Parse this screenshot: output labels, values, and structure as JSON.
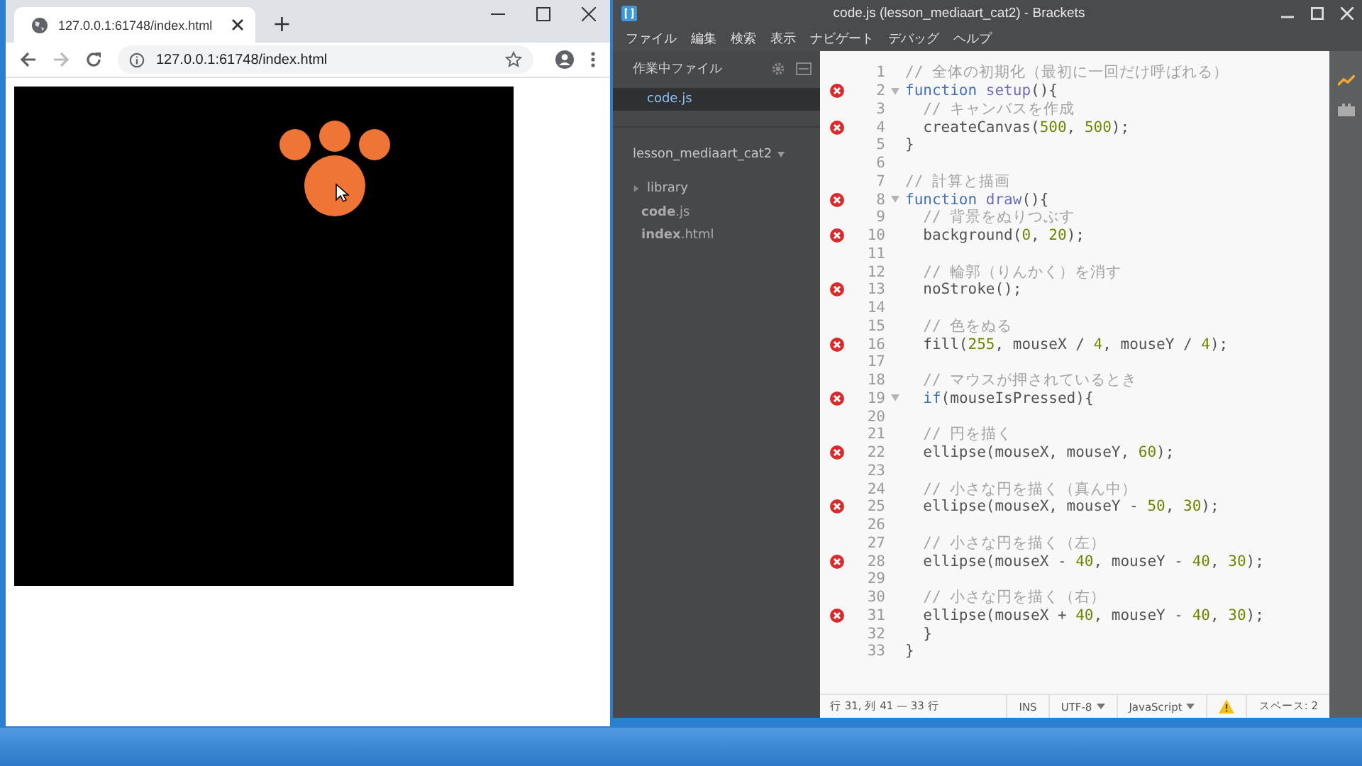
{
  "browser": {
    "tab_title": "127.0.0.1:61748/index.html",
    "new_tab": "+",
    "url": "127.0.0.1:61748/index.html"
  },
  "editor": {
    "title": "code.js (lesson_mediaart_cat2) - Brackets",
    "menu": [
      "ファイル",
      "編集",
      "検索",
      "表示",
      "ナビゲート",
      "デバッグ",
      "ヘルプ"
    ],
    "working_files": {
      "title": "作業中ファイル",
      "items": [
        {
          "name": "code.js",
          "selected": true
        }
      ]
    },
    "project": {
      "name": "lesson_mediaart_cat2",
      "tree": [
        {
          "name": "library",
          "kind": "folder",
          "expanded": false
        },
        {
          "name": "**code**.js",
          "kind": "file"
        },
        {
          "name": "**index**.html",
          "kind": "file"
        }
      ]
    },
    "lines": [
      {
        "number": "1",
        "error": false,
        "fold": false,
        "tokens": [
          {
            "kind": "comment",
            "text": "// 全体の初期化（最初に一回だけ呼ばれる）"
          }
        ]
      },
      {
        "number": "2",
        "error": true,
        "fold": true,
        "tokens": [
          {
            "kind": "keyword",
            "text": "function "
          },
          {
            "kind": "def",
            "text": "setup"
          },
          {
            "kind": "plain",
            "text": "(){"
          }
        ]
      },
      {
        "number": "3",
        "error": false,
        "fold": false,
        "tokens": [
          {
            "kind": "comment",
            "text": "  // キャンバスを作成"
          }
        ]
      },
      {
        "number": "4",
        "error": true,
        "fold": false,
        "tokens": [
          {
            "kind": "plain",
            "text": "  createCanvas("
          },
          {
            "kind": "number",
            "text": "500"
          },
          {
            "kind": "plain",
            "text": ", "
          },
          {
            "kind": "number",
            "text": "500"
          },
          {
            "kind": "plain",
            "text": ");"
          }
        ]
      },
      {
        "number": "5",
        "error": false,
        "fold": false,
        "tokens": [
          {
            "kind": "plain",
            "text": "}"
          }
        ]
      },
      {
        "number": "6",
        "error": false,
        "fold": false
      },
      {
        "number": "7",
        "error": false,
        "fold": false,
        "tokens": [
          {
            "kind": "comment",
            "text": "// 計算と描画"
          }
        ]
      },
      {
        "number": "8",
        "error": true,
        "fold": true,
        "tokens": [
          {
            "kind": "keyword",
            "text": "function "
          },
          {
            "kind": "def",
            "text": "draw"
          },
          {
            "kind": "plain",
            "text": "(){"
          }
        ]
      },
      {
        "number": "9",
        "error": false,
        "fold": false,
        "tokens": [
          {
            "kind": "comment",
            "text": "  // 背景をぬりつぶす"
          }
        ]
      },
      {
        "number": "10",
        "error": true,
        "fold": false,
        "tokens": [
          {
            "kind": "plain",
            "text": "  background("
          },
          {
            "kind": "number",
            "text": "0"
          },
          {
            "kind": "plain",
            "text": ", "
          },
          {
            "kind": "number",
            "text": "20"
          },
          {
            "kind": "plain",
            "text": ");"
          }
        ]
      },
      {
        "number": "11",
        "error": false,
        "fold": false
      },
      {
        "number": "12",
        "error": false,
        "fold": false,
        "tokens": [
          {
            "kind": "comment",
            "text": "  // 輪郭（りんかく）を消す"
          }
        ]
      },
      {
        "number": "13",
        "error": true,
        "fold": false,
        "tokens": [
          {
            "kind": "plain",
            "text": "  noStroke();"
          }
        ]
      },
      {
        "number": "14",
        "error": false,
        "fold": false
      },
      {
        "number": "15",
        "error": false,
        "fold": false,
        "tokens": [
          {
            "kind": "comment",
            "text": "  // 色をぬる"
          }
        ]
      },
      {
        "number": "16",
        "error": true,
        "fold": false,
        "tokens": [
          {
            "kind": "plain",
            "text": "  fill("
          },
          {
            "kind": "number",
            "text": "255"
          },
          {
            "kind": "plain",
            "text": ", mouseX / "
          },
          {
            "kind": "number",
            "text": "4"
          },
          {
            "kind": "plain",
            "text": ", mouseY / "
          },
          {
            "kind": "number",
            "text": "4"
          },
          {
            "kind": "plain",
            "text": ");"
          }
        ]
      },
      {
        "number": "17",
        "error": false,
        "fold": false
      },
      {
        "number": "18",
        "error": false,
        "fold": false,
        "tokens": [
          {
            "kind": "comment",
            "text": "  // マウスが押されているとき"
          }
        ]
      },
      {
        "number": "19",
        "error": true,
        "fold": true,
        "tokens": [
          {
            "kind": "keyword",
            "text": "  if"
          },
          {
            "kind": "plain",
            "text": "(mouseIsPressed){"
          }
        ]
      },
      {
        "number": "20",
        "error": false,
        "fold": false
      },
      {
        "number": "21",
        "error": false,
        "fold": false,
        "tokens": [
          {
            "kind": "comment",
            "text": "  // 円を描く"
          }
        ]
      },
      {
        "number": "22",
        "error": true,
        "fold": false,
        "tokens": [
          {
            "kind": "plain",
            "text": "  ellipse(mouseX, mouseY, "
          },
          {
            "kind": "number",
            "text": "60"
          },
          {
            "kind": "plain",
            "text": ");"
          }
        ]
      },
      {
        "number": "23",
        "error": false,
        "fold": false
      },
      {
        "number": "24",
        "error": false,
        "fold": false,
        "tokens": [
          {
            "kind": "comment",
            "text": "  // 小さな円を描く（真ん中）"
          }
        ]
      },
      {
        "number": "25",
        "error": true,
        "fold": false,
        "tokens": [
          {
            "kind": "plain",
            "text": "  ellipse(mouseX, mouseY - "
          },
          {
            "kind": "number",
            "text": "50"
          },
          {
            "kind": "plain",
            "text": ", "
          },
          {
            "kind": "number",
            "text": "30"
          },
          {
            "kind": "plain",
            "text": ");"
          }
        ]
      },
      {
        "number": "26",
        "error": false,
        "fold": false
      },
      {
        "number": "27",
        "error": false,
        "fold": false,
        "tokens": [
          {
            "kind": "comment",
            "text": "  // 小さな円を描く（左）"
          }
        ]
      },
      {
        "number": "28",
        "error": true,
        "fold": false,
        "tokens": [
          {
            "kind": "plain",
            "text": "  ellipse(mouseX - "
          },
          {
            "kind": "number",
            "text": "40"
          },
          {
            "kind": "plain",
            "text": ", mouseY - "
          },
          {
            "kind": "number",
            "text": "40"
          },
          {
            "kind": "plain",
            "text": ", "
          },
          {
            "kind": "number",
            "text": "30"
          },
          {
            "kind": "plain",
            "text": ");"
          }
        ]
      },
      {
        "number": "29",
        "error": false,
        "fold": false
      },
      {
        "number": "30",
        "error": false,
        "fold": false,
        "tokens": [
          {
            "kind": "comment",
            "text": "  // 小さな円を描く（右）"
          }
        ]
      },
      {
        "number": "31",
        "error": true,
        "fold": false,
        "tokens": [
          {
            "kind": "plain",
            "text": "  ellipse(mouseX + "
          },
          {
            "kind": "number",
            "text": "40"
          },
          {
            "kind": "plain",
            "text": ", mouseY - "
          },
          {
            "kind": "number",
            "text": "40"
          },
          {
            "kind": "plain",
            "text": ", "
          },
          {
            "kind": "number",
            "text": "30"
          },
          {
            "kind": "plain",
            "text": ");"
          }
        ]
      },
      {
        "number": "32",
        "error": false,
        "fold": false,
        "tokens": [
          {
            "kind": "plain",
            "text": "  }"
          }
        ]
      },
      {
        "number": "33",
        "error": false,
        "fold": false,
        "tokens": [
          {
            "kind": "plain",
            "text": "}"
          }
        ]
      }
    ],
    "status": {
      "position": "行 31, 列 41 — 33 行",
      "mode": "INS",
      "encoding": "UTF-8",
      "language": "JavaScript",
      "spaces": "スペース: 2"
    }
  }
}
